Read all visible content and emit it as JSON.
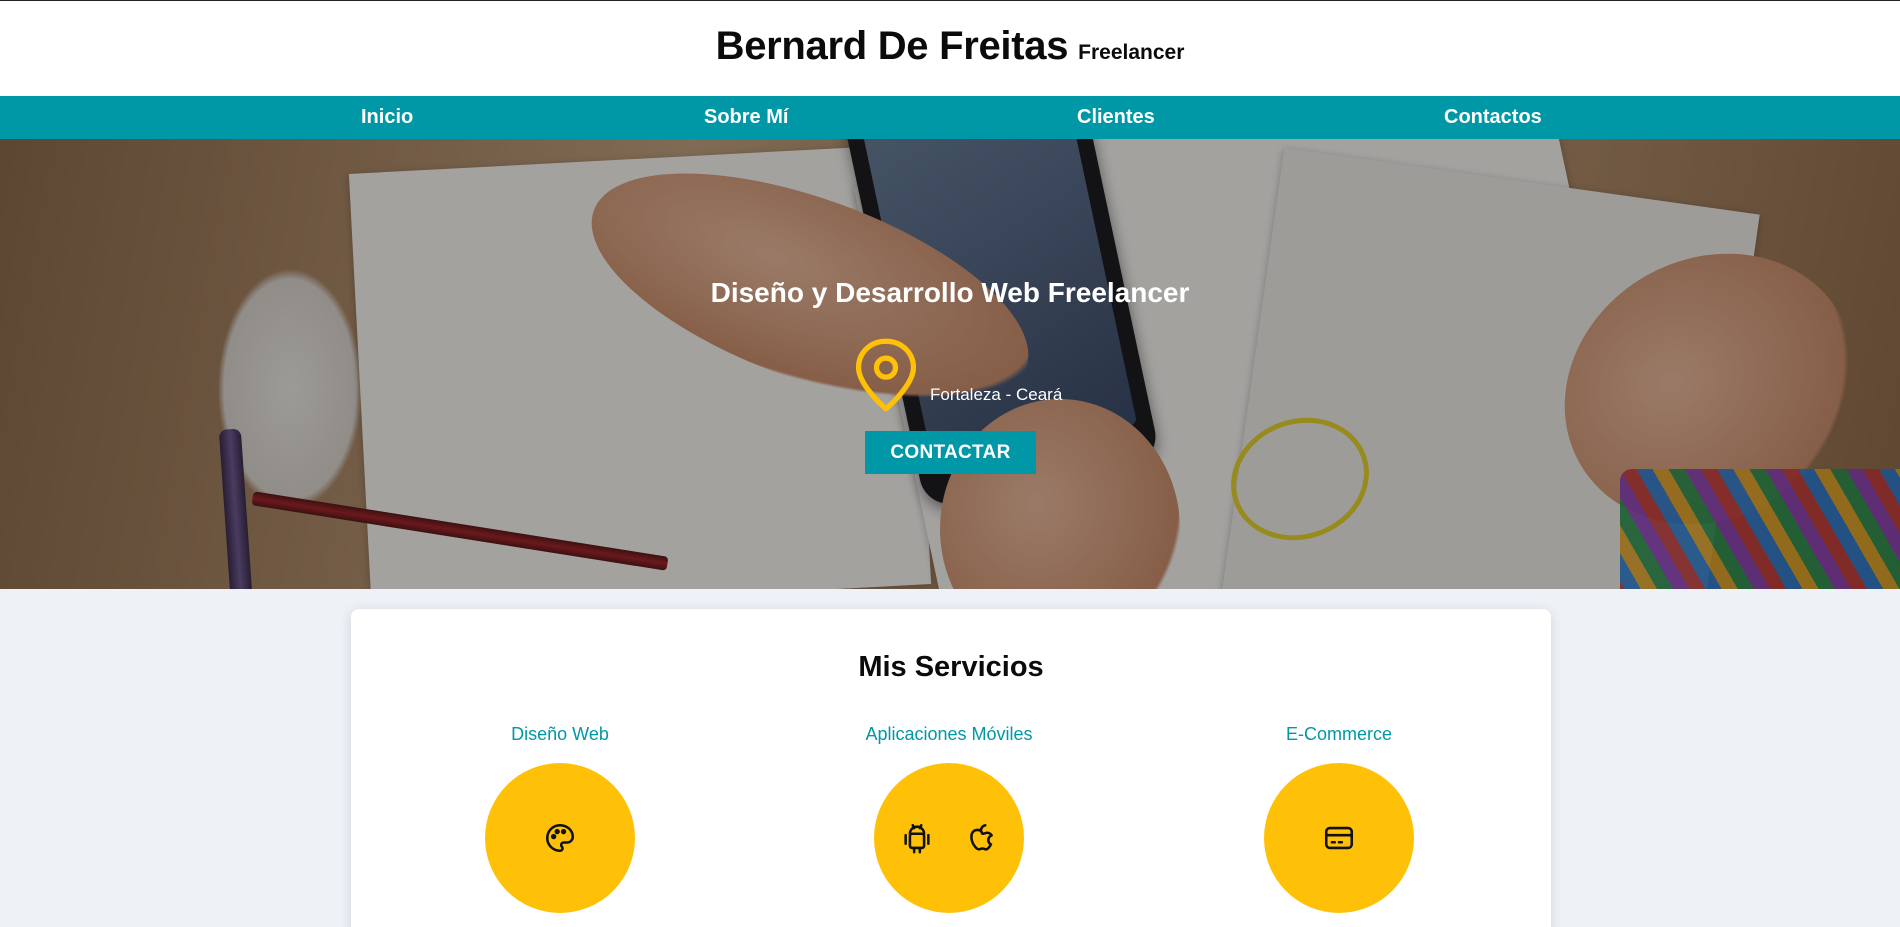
{
  "header": {
    "brand_name": "Bernard De Freitas",
    "brand_tag": "Freelancer"
  },
  "nav": {
    "items": [
      {
        "label": "Inicio"
      },
      {
        "label": "Sobre Mí"
      },
      {
        "label": "Clientes"
      },
      {
        "label": "Contactos"
      }
    ]
  },
  "hero": {
    "title": "Diseño y Desarrollo Web Freelancer",
    "location": "Fortaleza - Ceará",
    "location_icon": "map-pin-icon",
    "cta_label": "CONTACTAR"
  },
  "services": {
    "title": "Mis Servicios",
    "items": [
      {
        "label": "Diseño Web",
        "icons": [
          "palette-icon"
        ]
      },
      {
        "label": "Aplicaciones Móviles",
        "icons": [
          "android-icon",
          "apple-icon"
        ]
      },
      {
        "label": "E-Commerce",
        "icons": [
          "credit-card-icon"
        ]
      }
    ]
  },
  "colors": {
    "accent": "#0097a7",
    "highlight": "#ffc107",
    "background": "#eef2f7"
  }
}
